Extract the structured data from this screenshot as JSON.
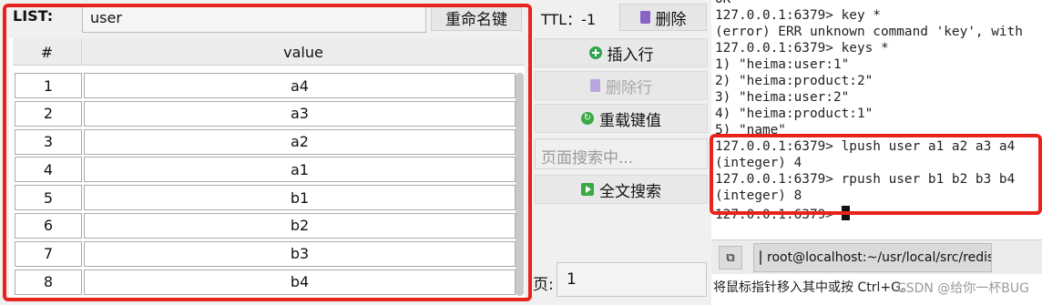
{
  "key_panel": {
    "type_label": "LIST:",
    "key_value": "user",
    "rename_label": "重命名键",
    "ttl_text": "TTL：-1",
    "delete_label": "删除"
  },
  "table": {
    "headers": [
      "#",
      "value"
    ],
    "rows": [
      {
        "idx": "1",
        "value": "a4"
      },
      {
        "idx": "2",
        "value": "a3"
      },
      {
        "idx": "3",
        "value": "a2"
      },
      {
        "idx": "4",
        "value": "a1"
      },
      {
        "idx": "5",
        "value": "b1"
      },
      {
        "idx": "6",
        "value": "b2"
      },
      {
        "idx": "7",
        "value": "b3"
      },
      {
        "idx": "8",
        "value": "b4"
      }
    ]
  },
  "actions": {
    "insert_row": "插入行",
    "delete_row": "删除行",
    "reload": "重载键值",
    "search_placeholder": "页面搜索中...",
    "fulltext": "全文搜索",
    "page_label": "页:",
    "page_value": "1"
  },
  "terminal": {
    "lines": [
      "OK",
      "127.0.0.1:6379> key *",
      "(error) ERR unknown command 'key', with",
      "127.0.0.1:6379> keys *",
      "1) \"heima:user:1\"",
      "2) \"heima:product:2\"",
      "3) \"heima:user:2\"",
      "4) \"heima:product:1\"",
      "5) \"name\"",
      "127.0.0.1:6379> lpush user a1 a2 a3 a4",
      "(integer) 4",
      "127.0.0.1:6379> rpush user b1 b2 b3 b4",
      "(integer) 8",
      "127.0.0.1:6379> "
    ]
  },
  "taskbar": {
    "task_title": "root@localhost:~/usr/local/src/redis...",
    "status_hint": "将鼠标指针移入其中或按 Ctrl+G。",
    "watermark": "CSDN @给你一杯BUG"
  },
  "colors": {
    "annotation": "#e8231c",
    "accent_green": "#2ea44f",
    "trash_purple": "#8a63c9"
  }
}
